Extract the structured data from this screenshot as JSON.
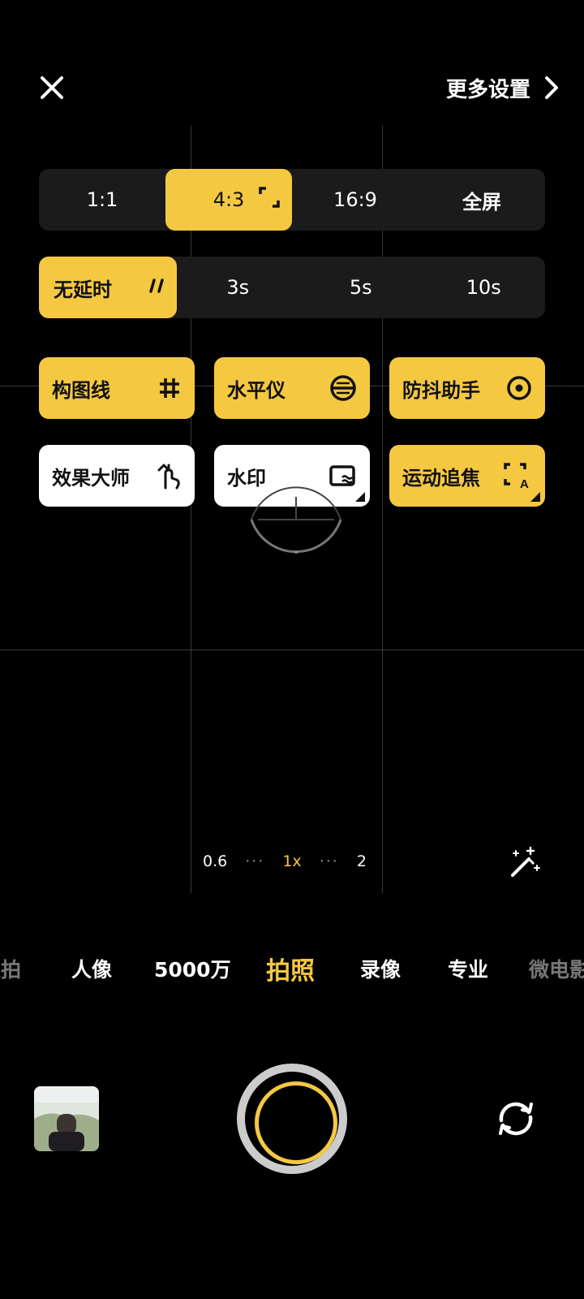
{
  "top_bar": {
    "more_settings_label": "更多设置"
  },
  "aspect_ratio": {
    "options": [
      "1:1",
      "4:3",
      "16:9",
      "全屏"
    ],
    "selected": "4:3"
  },
  "timer": {
    "options": [
      "无延时",
      "3s",
      "5s",
      "10s"
    ],
    "selected": "无延时"
  },
  "features": [
    {
      "label": "构图线",
      "icon": "grid-icon",
      "state": "on"
    },
    {
      "label": "水平仪",
      "icon": "level-icon",
      "state": "on"
    },
    {
      "label": "防抖助手",
      "icon": "stabilize-icon",
      "state": "on"
    },
    {
      "label": "效果大师",
      "icon": "gesture-icon",
      "state": "off"
    },
    {
      "label": "水印",
      "icon": "watermark-icon",
      "state": "off"
    },
    {
      "label": "运动追焦",
      "icon": "motion-focus-icon",
      "state": "on"
    }
  ],
  "zoom": {
    "levels": [
      "0.6",
      "1x",
      "2"
    ],
    "selected": "1x"
  },
  "modes": {
    "items": [
      "抓拍",
      "人像",
      "5000万",
      "拍照",
      "录像",
      "专业",
      "微电影"
    ],
    "selected": "拍照"
  },
  "colors": {
    "accent": "#f5c842",
    "panel": "#1b1b1b"
  }
}
